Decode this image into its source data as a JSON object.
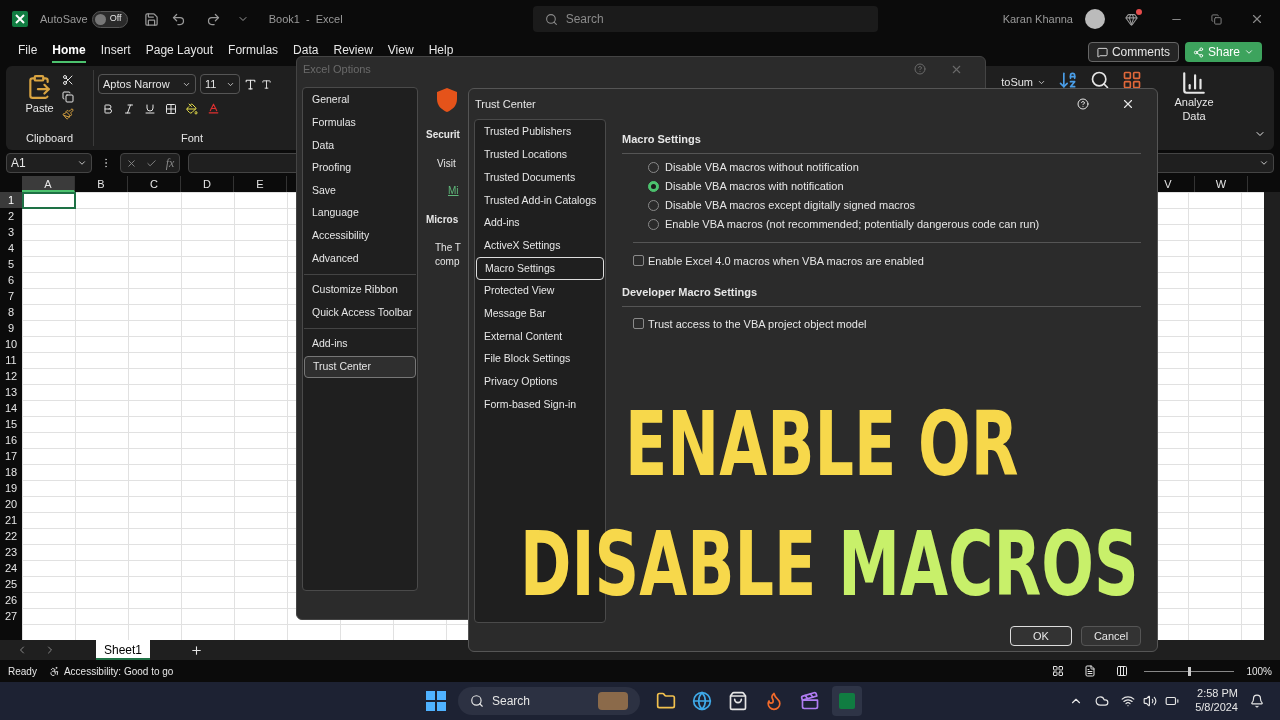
{
  "title_bar": {
    "autosave_label": "AutoSave",
    "autosave_toggle": {
      "text": "Off",
      "on": false
    },
    "document_title": "Book1  -  Excel",
    "search_placeholder": "Search",
    "user_name": "Karan Khanna"
  },
  "ribbon_tabs": [
    {
      "label": "File",
      "selected": false
    },
    {
      "label": "Home",
      "selected": true
    },
    {
      "label": "Insert",
      "selected": false
    },
    {
      "label": "Page Layout",
      "selected": false
    },
    {
      "label": "Formulas",
      "selected": false
    },
    {
      "label": "Data",
      "selected": false
    },
    {
      "label": "Review",
      "selected": false
    },
    {
      "label": "View",
      "selected": false
    },
    {
      "label": "Help",
      "selected": false
    }
  ],
  "comments_button": "Comments",
  "share_button": "Share",
  "ribbon": {
    "paste": "Paste",
    "clipboard_group": "Clipboard",
    "font_group": "Font",
    "font_name": "Aptos Narrow",
    "font_size": "11",
    "autosum": "toSum",
    "analyze_data": "Analyze Data"
  },
  "formula_bar": {
    "name_box": "A1",
    "function_button": "fx"
  },
  "grid": {
    "columns": [
      {
        "label": "A",
        "selected": true
      },
      {
        "label": "B",
        "selected": false
      },
      {
        "label": "C",
        "selected": false
      },
      {
        "label": "D",
        "selected": false
      },
      {
        "label": "E",
        "selected": false
      }
    ],
    "right_columns": [
      "V",
      "W"
    ],
    "rows": [
      {
        "label": "1",
        "selected": true
      },
      {
        "label": "2",
        "selected": false
      },
      {
        "label": "3",
        "selected": false
      },
      {
        "label": "4",
        "selected": false
      },
      {
        "label": "5",
        "selected": false
      },
      {
        "label": "6",
        "selected": false
      },
      {
        "label": "7",
        "selected": false
      },
      {
        "label": "8",
        "selected": false
      },
      {
        "label": "9",
        "selected": false
      },
      {
        "label": "10",
        "selected": false
      },
      {
        "label": "11",
        "selected": false
      },
      {
        "label": "12",
        "selected": false
      },
      {
        "label": "13",
        "selected": false
      },
      {
        "label": "14",
        "selected": false
      },
      {
        "label": "15",
        "selected": false
      },
      {
        "label": "16",
        "selected": false
      },
      {
        "label": "17",
        "selected": false
      },
      {
        "label": "18",
        "selected": false
      },
      {
        "label": "19",
        "selected": false
      },
      {
        "label": "20",
        "selected": false
      },
      {
        "label": "21",
        "selected": false
      },
      {
        "label": "22",
        "selected": false
      },
      {
        "label": "23",
        "selected": false
      },
      {
        "label": "24",
        "selected": false
      },
      {
        "label": "25",
        "selected": false
      },
      {
        "label": "26",
        "selected": false
      },
      {
        "label": "27",
        "selected": false
      }
    ]
  },
  "sheet_tabs": [
    {
      "label": "Sheet1",
      "selected": true
    }
  ],
  "status_bar": {
    "ready": "Ready",
    "accessibility": "Accessibility: Good to go",
    "zoom": "100%",
    "zoom_slider": {
      "level": 0.5
    }
  },
  "taskbar": {
    "search_placeholder": "Search",
    "time": "2:58 PM",
    "date": "5/8/2024"
  },
  "excel_options": {
    "title": "Excel Options",
    "nav_groups": [
      [
        {
          "label": "General",
          "selected": false
        },
        {
          "label": "Formulas",
          "selected": false
        },
        {
          "label": "Data",
          "selected": false
        },
        {
          "label": "Proofing",
          "selected": false
        },
        {
          "label": "Save",
          "selected": false
        },
        {
          "label": "Language",
          "selected": false
        },
        {
          "label": "Accessibility",
          "selected": false
        },
        {
          "label": "Advanced",
          "selected": false
        }
      ],
      [
        {
          "label": "Customize Ribbon",
          "selected": false
        },
        {
          "label": "Quick Access Toolbar",
          "selected": false
        }
      ],
      [
        {
          "label": "Add-ins",
          "selected": false
        },
        {
          "label": "Trust Center",
          "selected": true
        }
      ]
    ],
    "security_heading": "Securit",
    "visit_text": "Visit",
    "link_text": "Mi",
    "microsoft_heading": "Micros",
    "body_lines": [
      "The T",
      "comp"
    ]
  },
  "trust_center": {
    "title": "Trust Center",
    "nav": [
      {
        "label": "Trusted Publishers",
        "selected": false
      },
      {
        "label": "Trusted Locations",
        "selected": false
      },
      {
        "label": "Trusted Documents",
        "selected": false
      },
      {
        "label": "Trusted Add-in Catalogs",
        "selected": false
      },
      {
        "label": "Add-ins",
        "selected": false
      },
      {
        "label": "ActiveX Settings",
        "selected": false
      },
      {
        "label": "Macro Settings",
        "selected": true
      },
      {
        "label": "Protected View",
        "selected": false
      },
      {
        "label": "Message Bar",
        "selected": false
      },
      {
        "label": "External Content",
        "selected": false
      },
      {
        "label": "File Block Settings",
        "selected": false
      },
      {
        "label": "Privacy Options",
        "selected": false
      },
      {
        "label": "Form-based Sign-in",
        "selected": false
      }
    ],
    "macro_heading": "Macro Settings",
    "macro_options": [
      {
        "label": "Disable VBA macros without notification",
        "selected": false
      },
      {
        "label": "Disable VBA macros with notification",
        "selected": true
      },
      {
        "label": "Disable VBA macros except digitally signed macros",
        "selected": false
      },
      {
        "label": "Enable VBA macros (not recommended; potentially dangerous code can run)",
        "selected": false
      }
    ],
    "excel4_checkbox": {
      "label": "Enable Excel 4.0 macros when VBA macros are enabled",
      "checked": false
    },
    "developer_heading": "Developer Macro Settings",
    "vba_checkbox": {
      "label": "Trust access to the VBA project object model",
      "checked": false
    },
    "ok_button": "OK",
    "cancel_button": "Cancel"
  },
  "overlay_title": [
    {
      "parts": [
        {
          "text": "ENABLE OR",
          "color": "#f7d84b"
        }
      ]
    },
    {
      "parts": [
        {
          "text": "DISABLE",
          "color": "#f7d84b"
        },
        {
          "text": "MACROS",
          "color": "#c8f06a"
        }
      ]
    }
  ]
}
